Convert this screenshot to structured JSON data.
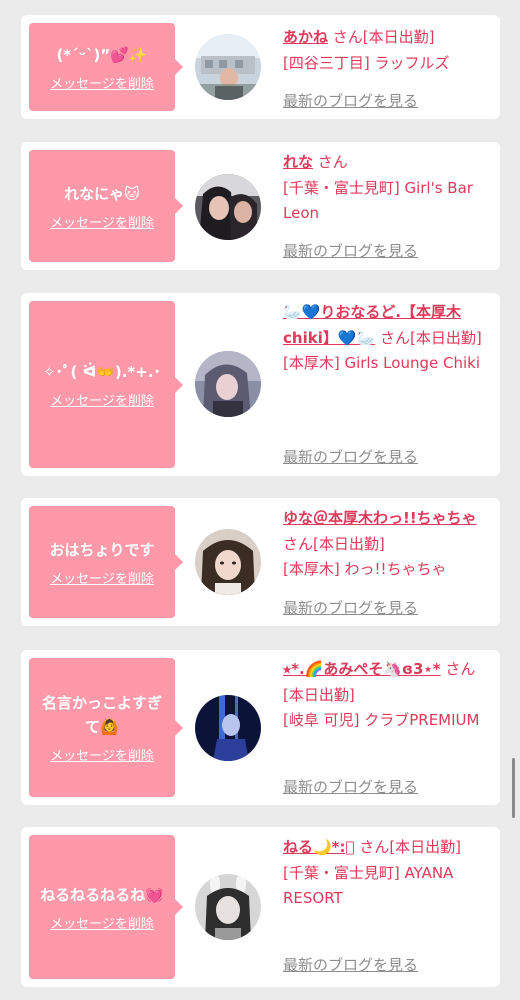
{
  "delete_label": "メッセージを削除",
  "blog_label": "最新のブログを見る",
  "cards": [
    {
      "message": "(*ˊᵕˋ)”💕✨",
      "name": "あかね",
      "san": "さん[本日出勤]",
      "shop": "[四谷三丁目] ラッフルズ"
    },
    {
      "message": "れなにゃ🐱",
      "name": "れな",
      "san": "さん",
      "shop": "[千葉・富士見町] Girl's Bar Leon"
    },
    {
      "message": "✧･ﾟ( ᐛ👐).*+.･",
      "name": "🦢💙りおなるど.【本厚木chiki】💙🦢",
      "san": "さん[本日出勤]",
      "shop": "[本厚木] Girls Lounge Chiki"
    },
    {
      "message": "おはちょりです",
      "name": "ゆな＠本厚木わっ!!ちゃちゃ",
      "san": "さん[本日出勤]",
      "shop": "[本厚木] わっ!!ちゃちゃ"
    },
    {
      "message": "名言かっこよすぎて🙆",
      "name": "⭑*.🌈あみぺそ🦄ɞ3⋆*",
      "san": "さん[本日出勤]",
      "shop": "[岐阜 可児] クラブPREMIUM"
    },
    {
      "message": "ねるねるねるね💓",
      "name": "ねる🌙*:ﾟ",
      "san": "さん[本日出勤]",
      "shop": "[千葉・富士見町] AYANA RESORT"
    }
  ]
}
